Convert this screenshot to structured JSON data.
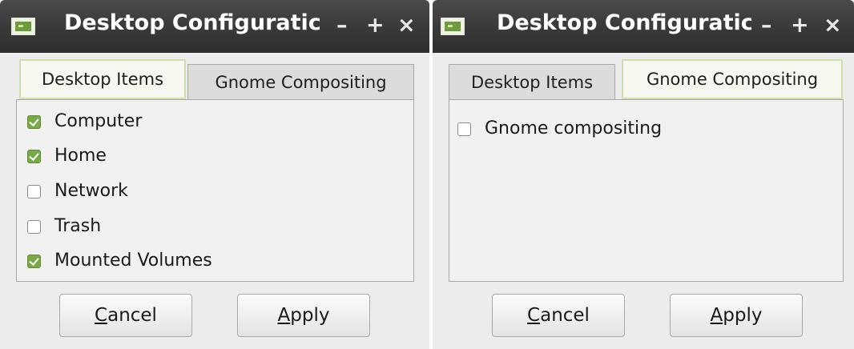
{
  "windows": [
    {
      "title": "Desktop Configuratic",
      "controls": {
        "minimize": "–",
        "maximize": "+",
        "close": "×"
      },
      "tabs": [
        {
          "label": "Desktop Items",
          "active": true
        },
        {
          "label": "Gnome Compositing",
          "active": false
        }
      ],
      "items": [
        {
          "label": "Computer",
          "checked": true
        },
        {
          "label": "Home",
          "checked": true
        },
        {
          "label": "Network",
          "checked": false
        },
        {
          "label": "Trash",
          "checked": false
        },
        {
          "label": "Mounted Volumes",
          "checked": true
        }
      ],
      "buttons": {
        "cancel": {
          "mnemonic": "C",
          "rest": "ancel"
        },
        "apply": {
          "mnemonic": "A",
          "rest": "pply"
        }
      }
    },
    {
      "title": "Desktop Configuratic",
      "controls": {
        "minimize": "–",
        "maximize": "+",
        "close": "×"
      },
      "tabs": [
        {
          "label": "Desktop Items",
          "active": false
        },
        {
          "label": "Gnome Compositing",
          "active": true
        }
      ],
      "items": [
        {
          "label": "Gnome compositing",
          "checked": false
        }
      ],
      "buttons": {
        "cancel": {
          "mnemonic": "C",
          "rest": "ancel"
        },
        "apply": {
          "mnemonic": "A",
          "rest": "pply"
        }
      }
    }
  ],
  "colors": {
    "titlebar": "#3a3a3a",
    "accent_green": "#77a947",
    "active_tab_border": "#cde0a8",
    "window_bg": "#ececec"
  },
  "icons": {
    "app": "desktop-config-icon",
    "check_on": "checkbox-checked",
    "check_off": "checkbox-unchecked"
  }
}
